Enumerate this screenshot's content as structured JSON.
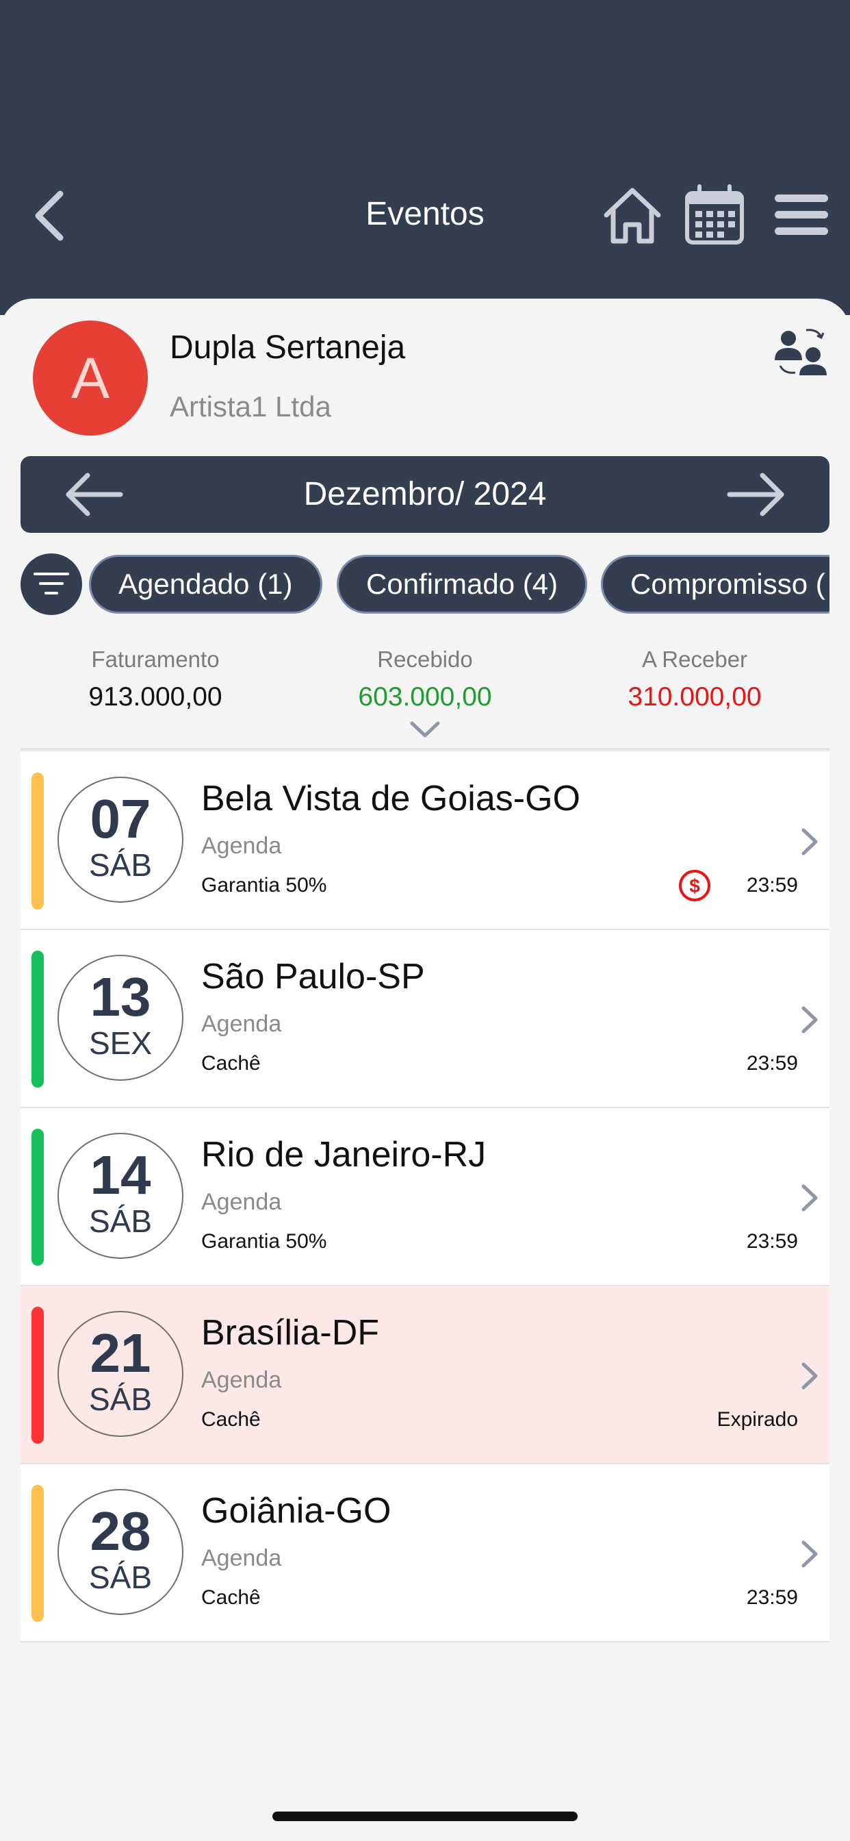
{
  "header": {
    "title": "Eventos"
  },
  "artist": {
    "avatar_letter": "A",
    "name": "Dupla Sertaneja",
    "company": "Artista1 Ltda"
  },
  "month": {
    "label": "Dezembro/ 2024"
  },
  "filters": [
    {
      "label": "Agendado (1)"
    },
    {
      "label": "Confirmado (4)"
    },
    {
      "label": "Compromisso ("
    }
  ],
  "summary": {
    "billing_label": "Faturamento",
    "billing_value": "913.000,00",
    "received_label": "Recebido",
    "received_value": "603.000,00",
    "receivable_label": "A Receber",
    "receivable_value": "310.000,00"
  },
  "colors": {
    "header_bg": "#343e51",
    "received": "#1f9e2e",
    "receivable": "#e81515",
    "status_yellow": "#fec150",
    "status_green": "#16c05b",
    "status_red": "#fe3333"
  },
  "events": [
    {
      "day": "07",
      "weekday": "SÁB",
      "city": "Bela Vista de Goias-GO",
      "type": "Agenda",
      "deal": "Garantia 50%",
      "time": "23:59",
      "status_color": "#fec150",
      "has_payment_icon": true
    },
    {
      "day": "13",
      "weekday": "SEX",
      "city": "São Paulo-SP",
      "type": "Agenda",
      "deal": "Cachê",
      "time": "23:59",
      "status_color": "#16c05b"
    },
    {
      "day": "14",
      "weekday": "SÁB",
      "city": "Rio de Janeiro-RJ",
      "type": "Agenda",
      "deal": "Garantia 50%",
      "time": "23:59",
      "status_color": "#16c05b"
    },
    {
      "day": "21",
      "weekday": "SÁB",
      "city": "Brasília-DF",
      "type": "Agenda",
      "deal": "Cachê",
      "time": "Expirado",
      "status_color": "#fe3333",
      "expired": true
    },
    {
      "day": "28",
      "weekday": "SÁB",
      "city": "Goiânia-GO",
      "type": "Agenda",
      "deal": "Cachê",
      "time": "23:59",
      "status_color": "#fec150"
    }
  ]
}
